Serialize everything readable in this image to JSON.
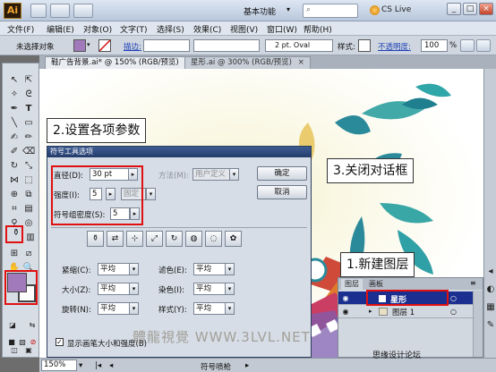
{
  "app": {
    "logo": "Ai",
    "workspace": "基本功能",
    "search": "CS Live"
  },
  "menu": [
    "文件(F)",
    "编辑(E)",
    "对象(O)",
    "文字(T)",
    "选择(S)",
    "效果(C)",
    "视图(V)",
    "窗口(W)",
    "帮助(H)"
  ],
  "control": {
    "selection": "未选择对象",
    "stroke_label": "描边:",
    "brush": "2 pt. Oval",
    "style_label": "样式:",
    "opacity_label": "不透明度:",
    "opacity_value": "100",
    "opacity_unit": "%"
  },
  "tabs": [
    {
      "label": "鞋广告背景.ai* @ 150% (RGB/预览)",
      "close": "×",
      "active": true
    },
    {
      "label": "星形.ai @ 300% (RGB/预览)",
      "close": "×",
      "active": false
    }
  ],
  "callouts": {
    "step1": "1.新建图层",
    "step2": "2.设置各项参数",
    "step3": "3.关闭对话框"
  },
  "dialog": {
    "title": "符号工具选项",
    "diameter_label": "直径(D):",
    "diameter_value": "30 pt",
    "method_label": "方法(M):",
    "method_value": "用户定义",
    "intensity_label": "强度(I):",
    "intensity_value": "5",
    "intensity_mode": "固定",
    "density_label": "符号组密度(S):",
    "density_value": "5",
    "ok": "确定",
    "cancel": "取消",
    "scrunch_label": "紧缩(C):",
    "scrunch_value": "平均",
    "size_label": "大小(Z):",
    "size_value": "平均",
    "spin_label": "旋转(N):",
    "spin_value": "平均",
    "screen_label": "滤色(E):",
    "screen_value": "平均",
    "stain_label": "染色(I):",
    "stain_value": "平均",
    "style_label": "样式(Y):",
    "style_value": "平均",
    "checkbox_label": "显示画笔大小和强度(B)",
    "checkbox_mark": "✓"
  },
  "layers": {
    "tab_layers": "图层",
    "tab_artboard": "画板",
    "rows": [
      {
        "name": "星形",
        "selected": true
      },
      {
        "name": "图层 1",
        "selected": false
      }
    ]
  },
  "status": {
    "zoom": "150%",
    "tool_name": "符号喷枪",
    "watermark": "思缘设计论坛"
  },
  "watermark": "體龍視覺 WWW.3LVL.NET"
}
